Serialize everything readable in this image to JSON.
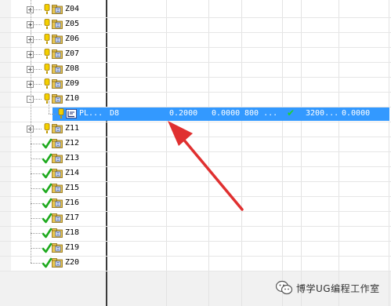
{
  "tree": {
    "nodes": [
      {
        "name": "Z04",
        "status": "warning",
        "expander": "+",
        "selected": false
      },
      {
        "name": "Z05",
        "status": "warning",
        "expander": "+",
        "selected": false
      },
      {
        "name": "Z06",
        "status": "warning",
        "expander": "+",
        "selected": false
      },
      {
        "name": "Z07",
        "status": "warning",
        "expander": "+",
        "selected": false
      },
      {
        "name": "Z08",
        "status": "warning",
        "expander": "+",
        "selected": false
      },
      {
        "name": "Z09",
        "status": "warning",
        "expander": "+",
        "selected": false
      },
      {
        "name": "Z10",
        "status": "warning",
        "expander": "-",
        "selected": false
      },
      {
        "name": "PL...",
        "status": "warning",
        "expander": "",
        "selected": true,
        "child": true
      },
      {
        "name": "Z11",
        "status": "warning",
        "expander": "+",
        "selected": false
      },
      {
        "name": "Z12",
        "status": "done",
        "expander": "",
        "selected": false
      },
      {
        "name": "Z13",
        "status": "done",
        "expander": "",
        "selected": false
      },
      {
        "name": "Z14",
        "status": "done",
        "expander": "",
        "selected": false
      },
      {
        "name": "Z15",
        "status": "done",
        "expander": "",
        "selected": false
      },
      {
        "name": "Z16",
        "status": "done",
        "expander": "",
        "selected": false
      },
      {
        "name": "Z17",
        "status": "done",
        "expander": "",
        "selected": false
      },
      {
        "name": "Z18",
        "status": "done",
        "expander": "",
        "selected": false
      },
      {
        "name": "Z19",
        "status": "done",
        "expander": "",
        "selected": false
      },
      {
        "name": "Z20",
        "status": "done",
        "expander": "",
        "selected": false
      }
    ]
  },
  "selected_row": {
    "tool": "D8",
    "value1": "0.2000",
    "value2": "0.0000",
    "value3": "800 ...",
    "check": "✔",
    "value4": "3200...",
    "value5": "0.0000"
  },
  "watermark": {
    "text": "博学UG编程工作室"
  },
  "colors": {
    "selection": "#3399ff",
    "warning": "#e8c400",
    "done": "#1faa1f",
    "arrow": "#e03030"
  }
}
